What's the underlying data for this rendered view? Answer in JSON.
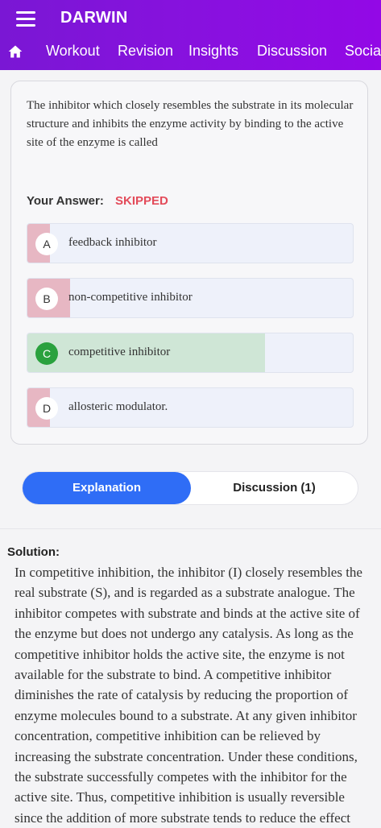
{
  "app": {
    "title": "DARWIN",
    "menu_icon": "hamburger-menu-icon",
    "home_icon": "home-icon"
  },
  "nav": {
    "tabs": [
      "Workout",
      "Revision",
      "Insights",
      "Discussion",
      "Social"
    ]
  },
  "question": {
    "text": "The inhibitor which closely resembles the substrate in its molecular structure and inhibits the enzyme activity by binding to the active site of the enzyme is called",
    "your_answer_label": "Your Answer:",
    "your_answer_value": "SKIPPED",
    "options": [
      {
        "letter": "A",
        "text": "feedback inhibitor",
        "response_share": 0.07,
        "correct": false
      },
      {
        "letter": "B",
        "text": "non-competitive inhibitor",
        "response_share": 0.13,
        "correct": false
      },
      {
        "letter": "C",
        "text": "competitive inhibitor",
        "response_share": 0.73,
        "correct": true
      },
      {
        "letter": "D",
        "text": "allosteric modulator.",
        "response_share": 0.07,
        "correct": false
      }
    ]
  },
  "tabs_panel": {
    "explanation_label": "Explanation",
    "discussion_label": "Discussion (1)"
  },
  "solution": {
    "label": "Solution:",
    "text": "In competitive inhibition, the inhibitor (I) closely resembles the real substrate (S), and is regarded as a substrate analogue. The inhibitor competes with substrate and binds at the active site of the enzyme but does not undergo any catalysis. As long as the competitive inhibitor holds the active site, the enzyme is not available for the substrate to bind. A competitive inhibitor diminishes the rate of catalysis by reducing the proportion of enzyme molecules bound to a substrate. At any given inhibitor concentration, competitive inhibition can be relieved by increasing the substrate concentration. Under these conditions, the substrate successfully competes with the inhibitor for the active site. Thus, competitive inhibition is usually reversible since the addition of more substrate tends to reduce the effect"
  },
  "colors": {
    "appbar": "#8a10e0",
    "wrong_fill": "#e7b7c3",
    "correct_fill": "#cfe6d6",
    "correct_badge": "#2aa13e",
    "skipped": "#e34b5a",
    "active_tab": "#2f6df6"
  }
}
